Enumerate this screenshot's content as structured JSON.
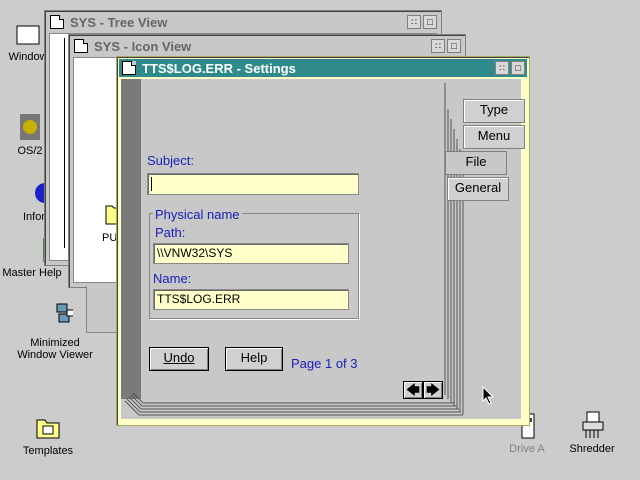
{
  "desktop": {
    "icons": [
      {
        "label": "Window"
      },
      {
        "label": "OS/2"
      },
      {
        "label": "Infor"
      },
      {
        "label": "Master Help"
      },
      {
        "label": "Minimized",
        "label2": "Window Viewer"
      },
      {
        "label": "Templates"
      },
      {
        "label": "Drive A"
      },
      {
        "label": "Shredder"
      }
    ]
  },
  "tree_window": {
    "title": "SYS - Tree View"
  },
  "icon_window": {
    "title": "SYS - Icon View",
    "partial_label": "PU"
  },
  "settings": {
    "title": "TTS$LOG.ERR - Settings",
    "subject_label": "Subject:",
    "subject_value": "",
    "group_label": "Physical name",
    "path_label": "Path:",
    "path_value": "\\\\VNW32\\SYS",
    "name_label": "Name:",
    "name_value": "TTS$LOG.ERR",
    "undo_label": "Undo",
    "help_label": "Help",
    "page_indicator": "Page 1 of 3",
    "tabs": [
      "Type",
      "Menu",
      "File",
      "General"
    ]
  },
  "colors": {
    "desktop": "#cccccc",
    "active_title": "#2f8b8b",
    "field_bg": "#ffffc8",
    "accent_text": "#1a20b8"
  }
}
